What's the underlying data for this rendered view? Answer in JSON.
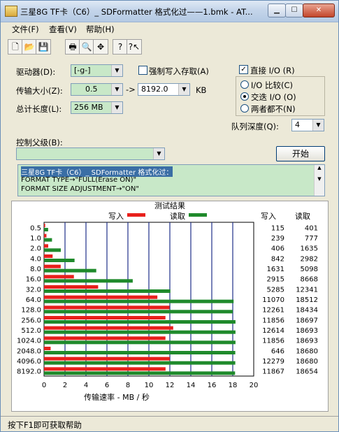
{
  "window": {
    "title": "三星8G TF卡（C6）_ SDFormatter 格式化过——1.bmk - AT..."
  },
  "menu": [
    "文件(F)",
    "查看(V)",
    "帮助(H)"
  ],
  "toolbar_icons": [
    "new-icon",
    "open-icon",
    "save-icon",
    "print-icon",
    "print-preview-icon",
    "move-icon",
    "help-icon",
    "context-help-icon"
  ],
  "form": {
    "drive_label": "驱动器(D):",
    "drive_value": "[-g-]",
    "force_write_label": "强制写入存取(A)",
    "transfer_size_label": "传输大小(Z):",
    "transfer_from": "0.5",
    "transfer_to": "8192.0",
    "transfer_unit": "KB",
    "total_length_label": "总计长度(L):",
    "total_length_value": "256 MB",
    "direct_io_label": "直接 I/O (R)",
    "radio_io_compare": "I/O 比较(C)",
    "radio_overlap": "交迭 I/O (O)",
    "radio_neither": "两者都不(N)",
    "queue_depth_label": "队列深度(Q):",
    "queue_depth_value": "4",
    "control_label": "控制父级(B):",
    "start_button": "开始",
    "description_lines": [
      "三星8G TF卡（C6）_ SDFormatter 格式化过：",
      "FORMAT TYPE→\"FULL(Erase ON)\"",
      "FORMAT SIZE ADJUSTMENT→\"ON\""
    ]
  },
  "status_text": "按下F1即可获取帮助",
  "colors": {
    "write": "#e8201c",
    "read": "#1f8a2b",
    "grid": "#1f2f8a"
  },
  "chart_data": {
    "type": "bar",
    "title": "测试结果",
    "xlabel": "传输速率 - MB / 秒",
    "xlim": [
      0,
      20
    ],
    "xticks": [
      "0",
      "2",
      "4",
      "6",
      "8",
      "10",
      "12",
      "14",
      "16",
      "18",
      "20"
    ],
    "legend": {
      "write": "写入",
      "read": "读取"
    },
    "categories": [
      "0.5",
      "1.0",
      "2.0",
      "4.0",
      "8.0",
      "16.0",
      "32.0",
      "64.0",
      "128.0",
      "256.0",
      "512.0",
      "1024.0",
      "2048.0",
      "4096.0",
      "8192.0"
    ],
    "series": [
      {
        "name": "写入",
        "values": [
          0.11,
          0.23,
          0.4,
          0.82,
          1.59,
          2.85,
          5.16,
          10.81,
          11.97,
          11.58,
          12.32,
          11.58,
          0.63,
          11.99,
          11.59
        ]
      },
      {
        "name": "读取",
        "values": [
          0.39,
          0.76,
          1.6,
          2.91,
          4.98,
          8.46,
          12.05,
          18.08,
          18.0,
          18.26,
          18.26,
          18.26,
          18.24,
          18.24,
          18.22
        ]
      }
    ],
    "table": {
      "header_write": "写入",
      "header_read": "读取",
      "write": [
        "115",
        "239",
        "406",
        "842",
        "1631",
        "2915",
        "5285",
        "11070",
        "12261",
        "11856",
        "12614",
        "11856",
        "646",
        "12279",
        "11867"
      ],
      "read": [
        "401",
        "777",
        "1635",
        "2982",
        "5098",
        "8668",
        "12341",
        "18512",
        "18434",
        "18697",
        "18693",
        "18693",
        "18680",
        "18680",
        "18654"
      ]
    }
  }
}
